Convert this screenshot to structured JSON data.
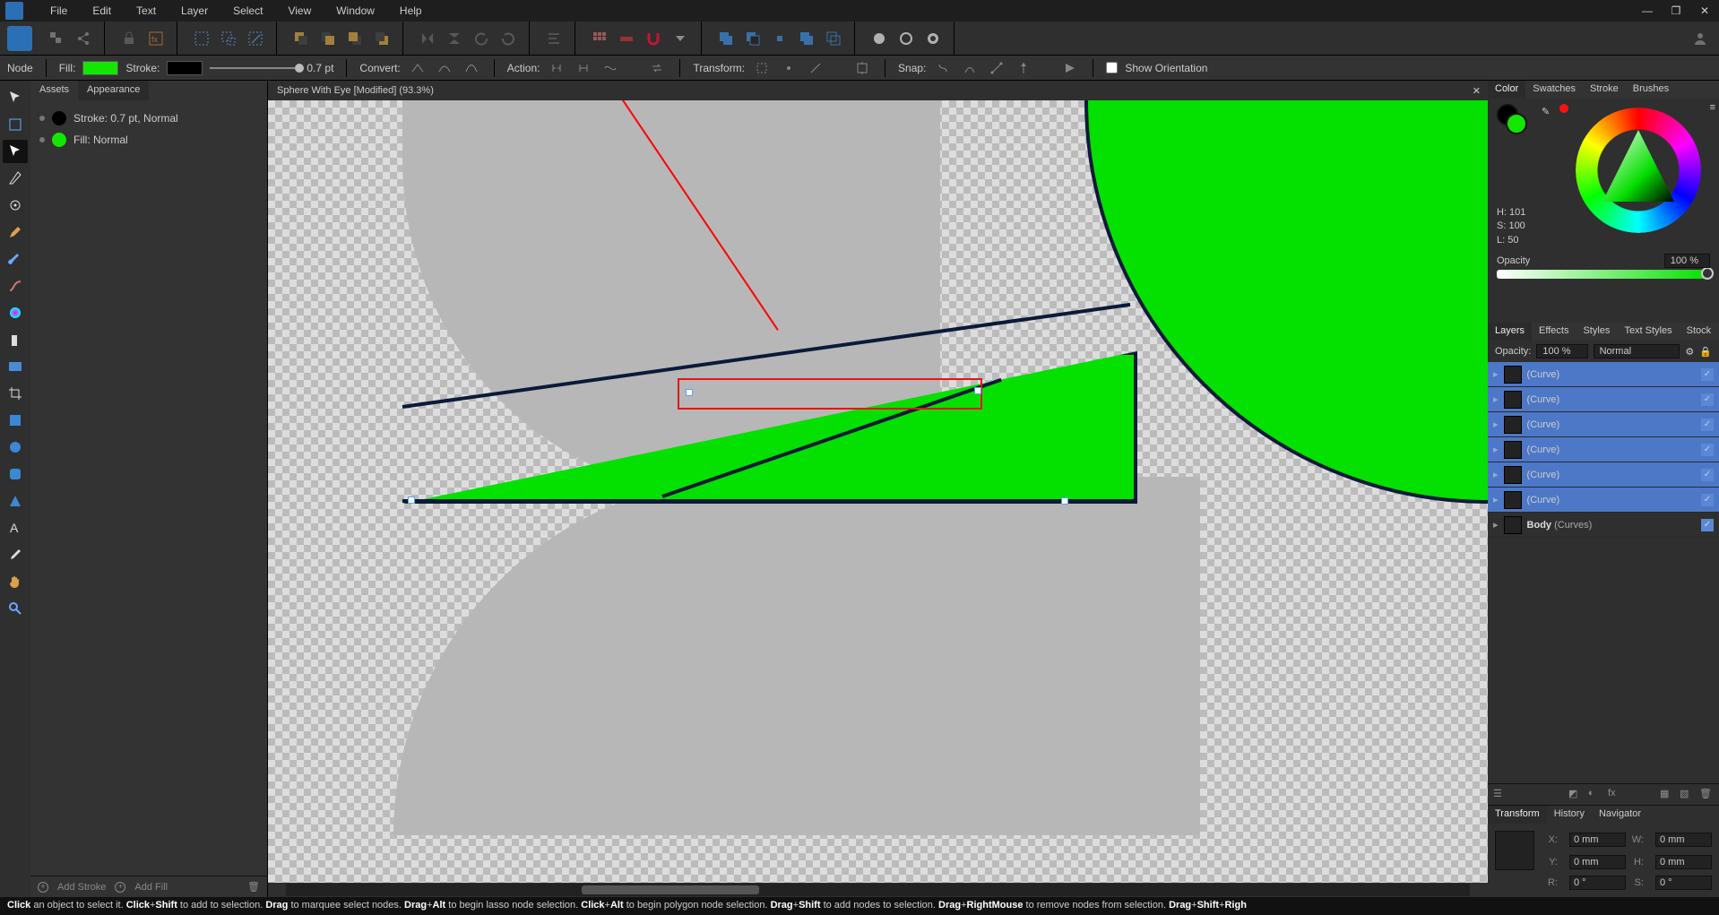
{
  "menu": [
    "File",
    "Edit",
    "Text",
    "Layer",
    "Select",
    "View",
    "Window",
    "Help"
  ],
  "context": {
    "mode": "Node",
    "fill_label": "Fill:",
    "fill_color": "#14e600",
    "stroke_label": "Stroke:",
    "stroke_color": "#000000",
    "stroke_width": "0.7 pt",
    "convert_label": "Convert:",
    "action_label": "Action:",
    "transform_label": "Transform:",
    "snap_label": "Snap:",
    "show_orientation": "Show Orientation"
  },
  "left_tabs": {
    "assets": "Assets",
    "appearance": "Appearance"
  },
  "appearance_rows": [
    {
      "color": "#000000",
      "text": "Stroke: 0.7 pt,  Normal"
    },
    {
      "color": "#14e600",
      "text": "Fill:  Normal"
    }
  ],
  "appearance_footer": {
    "add_stroke": "Add Stroke",
    "add_fill": "Add Fill"
  },
  "doc_tab": "Sphere With Eye [Modified] (93.3%)",
  "right_tabs1": [
    "Color",
    "Swatches",
    "Stroke",
    "Brushes"
  ],
  "hsl": {
    "h": "H: 101",
    "s": "S: 100",
    "l": "L: 50"
  },
  "opacity_label": "Opacity",
  "opacity_value": "100 %",
  "right_tabs2": [
    "Layers",
    "Effects",
    "Styles",
    "Text Styles",
    "Stock"
  ],
  "layers_header": {
    "opacity_label": "Opacity:",
    "opacity_value": "100 %",
    "blend": "Normal"
  },
  "layers": [
    {
      "name": "(Curve)",
      "sel": true
    },
    {
      "name": "(Curve)",
      "sel": true
    },
    {
      "name": "(Curve)",
      "sel": true
    },
    {
      "name": "(Curve)",
      "sel": true
    },
    {
      "name": "(Curve)",
      "sel": true
    },
    {
      "name": "(Curve)",
      "sel": true
    },
    {
      "name_bold": "Body",
      "name_suffix": "(Curves)",
      "sel": false
    }
  ],
  "right_tabs3": [
    "Transform",
    "History",
    "Navigator"
  ],
  "transform": {
    "x_label": "X:",
    "x_val": "0 mm",
    "y_label": "Y:",
    "y_val": "0 mm",
    "w_label": "W:",
    "w_val": "0 mm",
    "h_label": "H:",
    "h_val": "0 mm",
    "r_label": "R:",
    "r_val": "0 °",
    "s_label": "S:",
    "s_val": "0 °"
  },
  "status_parts": [
    {
      "b": "Click"
    },
    {
      "t": " an object to select it. "
    },
    {
      "b": "Click"
    },
    {
      "t": "+"
    },
    {
      "b": "Shift"
    },
    {
      "t": " to add to selection. "
    },
    {
      "b": "Drag"
    },
    {
      "t": " to marquee select nodes. "
    },
    {
      "b": "Drag"
    },
    {
      "t": "+"
    },
    {
      "b": "Alt"
    },
    {
      "t": " to begin lasso node selection. "
    },
    {
      "b": "Click"
    },
    {
      "t": "+"
    },
    {
      "b": "Alt"
    },
    {
      "t": " to begin polygon node selection. "
    },
    {
      "b": "Drag"
    },
    {
      "t": "+"
    },
    {
      "b": "Shift"
    },
    {
      "t": " to add nodes to selection. "
    },
    {
      "b": "Drag"
    },
    {
      "t": "+"
    },
    {
      "b": "RightMouse"
    },
    {
      "t": " to remove nodes from selection. "
    },
    {
      "b": "Drag"
    },
    {
      "t": "+"
    },
    {
      "b": "Shift"
    },
    {
      "t": "+"
    },
    {
      "b": "Righ"
    }
  ]
}
